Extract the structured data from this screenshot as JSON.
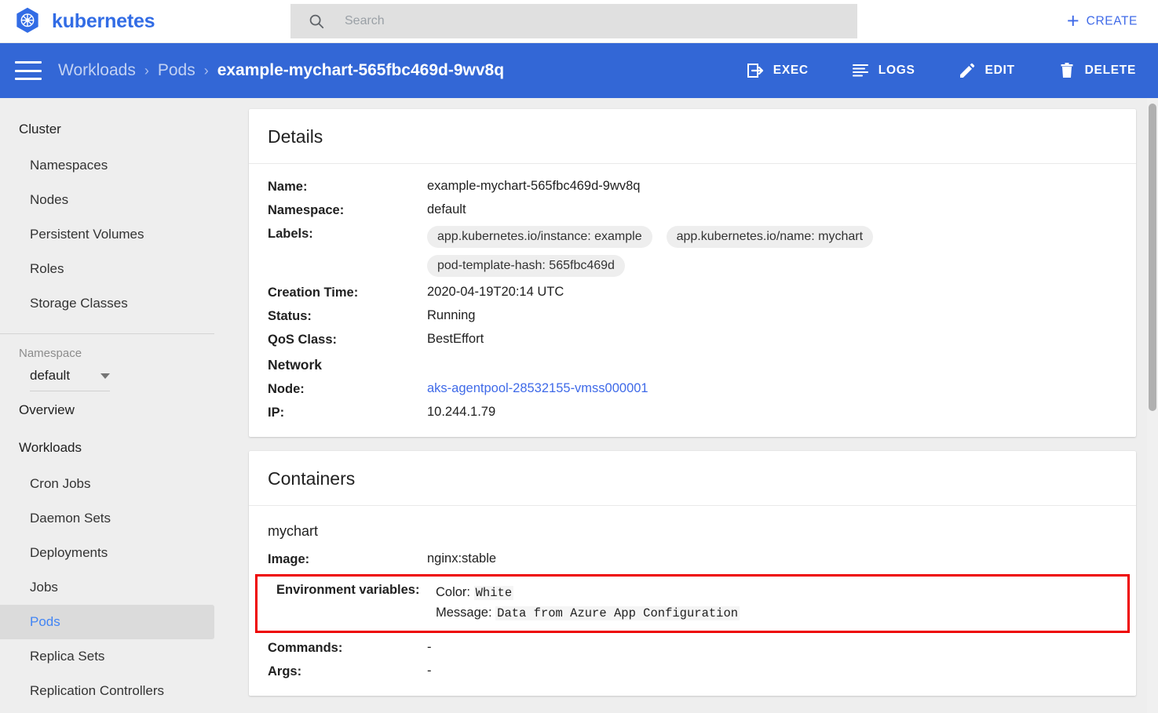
{
  "header": {
    "brand": "kubernetes",
    "logo_icon": "kubernetes-wheel-logo",
    "search_icon": "search-icon",
    "search_placeholder": "Search",
    "search_value": "",
    "create_icon": "plus-icon",
    "create_label": "CREATE",
    "accent_color": "#326ce5"
  },
  "actionbar": {
    "menu_icon": "hamburger-menu-icon",
    "background_color": "#3367d6",
    "breadcrumb": {
      "items": [
        {
          "label": "Workloads",
          "current": false
        },
        {
          "label": "Pods",
          "current": false
        },
        {
          "label": "example-mychart-565fbc469d-9wv8q",
          "current": true
        }
      ],
      "separator": "›"
    },
    "actions": [
      {
        "label": "EXEC",
        "icon": "exec-terminal-icon"
      },
      {
        "label": "LOGS",
        "icon": "logs-lines-icon"
      },
      {
        "label": "EDIT",
        "icon": "edit-pencil-icon"
      },
      {
        "label": "DELETE",
        "icon": "delete-trash-icon"
      }
    ]
  },
  "sidebar": {
    "cluster": {
      "title": "Cluster",
      "items": [
        {
          "label": "Namespaces",
          "active": false
        },
        {
          "label": "Nodes",
          "active": false
        },
        {
          "label": "Persistent Volumes",
          "active": false
        },
        {
          "label": "Roles",
          "active": false
        },
        {
          "label": "Storage Classes",
          "active": false
        }
      ]
    },
    "namespace": {
      "label": "Namespace",
      "selected": "default",
      "caret_icon": "chevron-down-icon"
    },
    "overview": {
      "title": "Overview"
    },
    "workloads": {
      "title": "Workloads",
      "items": [
        {
          "label": "Cron Jobs",
          "active": false
        },
        {
          "label": "Daemon Sets",
          "active": false
        },
        {
          "label": "Deployments",
          "active": false
        },
        {
          "label": "Jobs",
          "active": false
        },
        {
          "label": "Pods",
          "active": true
        },
        {
          "label": "Replica Sets",
          "active": false
        },
        {
          "label": "Replication Controllers",
          "active": false
        }
      ]
    },
    "active_item_color": "#4285f4",
    "active_item_background": "#dbdbdb"
  },
  "details_card": {
    "title": "Details",
    "rows": [
      {
        "key": "Name:",
        "value": "example-mychart-565fbc469d-9wv8q",
        "type": "text"
      },
      {
        "key": "Namespace:",
        "value": "default",
        "type": "text"
      }
    ],
    "labels_key": "Labels:",
    "labels": [
      "app.kubernetes.io/instance: example",
      "app.kubernetes.io/name: mychart",
      "pod-template-hash: 565fbc469d"
    ],
    "rows_after_labels": [
      {
        "key": "Creation Time:",
        "value": "2020-04-19T20:14 UTC",
        "type": "text"
      },
      {
        "key": "Status:",
        "value": "Running",
        "type": "text"
      },
      {
        "key": "QoS Class:",
        "value": "BestEffort",
        "type": "text"
      }
    ],
    "network_heading": "Network",
    "network_rows": [
      {
        "key": "Node:",
        "value": "aks-agentpool-28532155-vmss000001",
        "type": "link"
      },
      {
        "key": "IP:",
        "value": "10.244.1.79",
        "type": "text"
      }
    ]
  },
  "containers_card": {
    "title": "Containers",
    "container_name": "mychart",
    "image_key": "Image:",
    "image_value": "nginx:stable",
    "env_key": "Environment variables:",
    "env_vars": [
      {
        "name": "Color:",
        "value": "White"
      },
      {
        "name": "Message:",
        "value": "Data from Azure App Configuration"
      }
    ],
    "env_highlight_color": "#ee0000",
    "commands_key": "Commands:",
    "commands_value": "-",
    "args_key": "Args:",
    "args_value": "-"
  },
  "scrollbar": {
    "name": "main-scrollbar"
  }
}
